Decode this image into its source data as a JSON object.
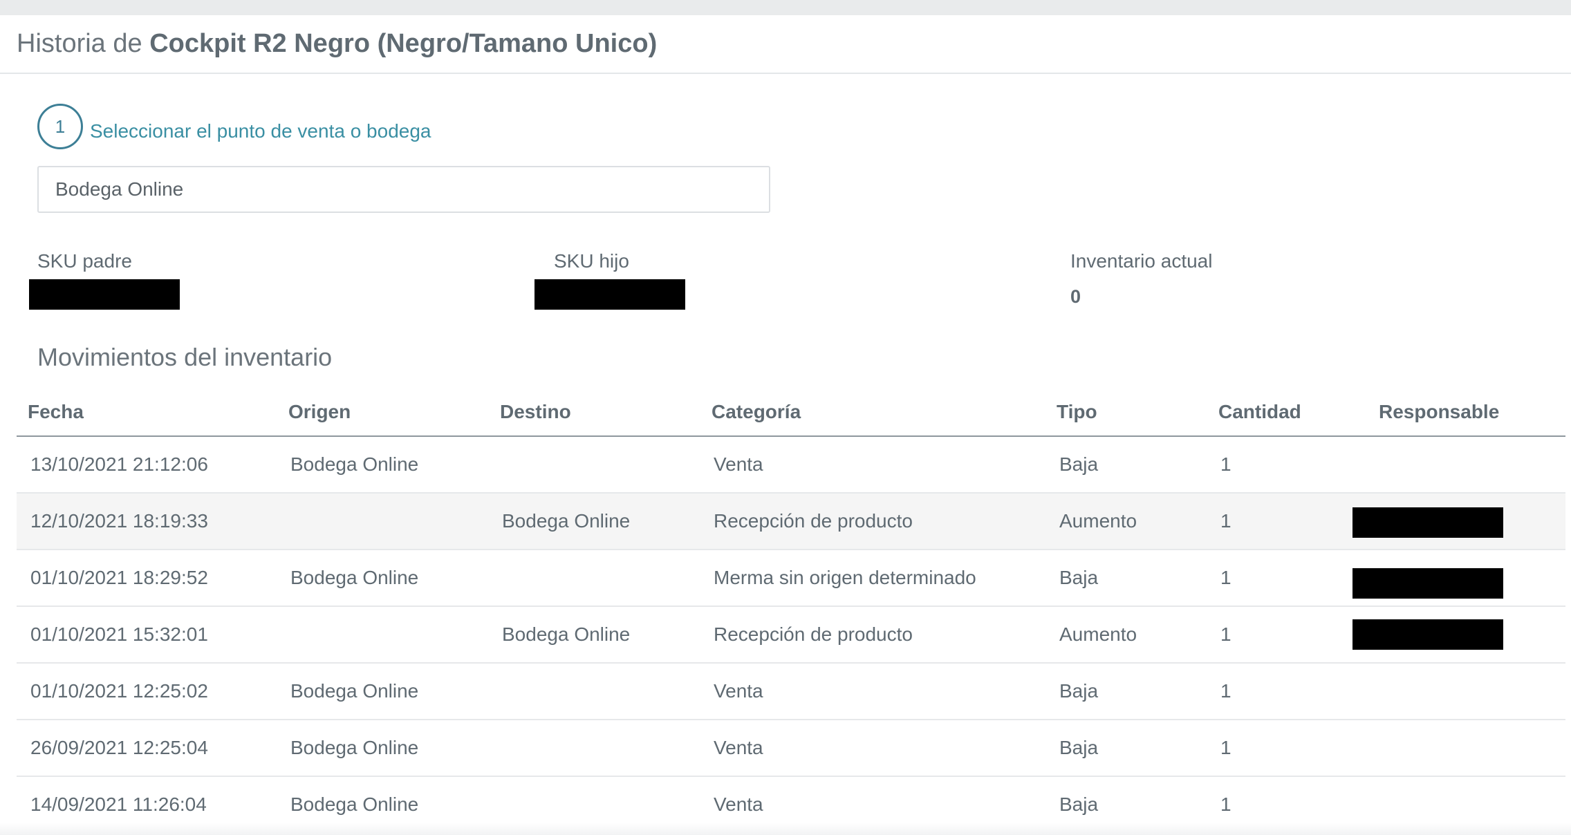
{
  "header": {
    "title_prefix": "Historia de",
    "product_name": "Cockpit R2 Negro (Negro/Tamano Unico)"
  },
  "step": {
    "number": "1",
    "label": "Seleccionar el punto de venta o bodega"
  },
  "location_select": {
    "value": "Bodega Online"
  },
  "info": {
    "sku_padre_label": "SKU padre",
    "sku_hijo_label": "SKU hijo",
    "inventario_label": "Inventario actual",
    "inventario_value": "0"
  },
  "movements": {
    "title": "Movimientos del inventario",
    "columns": {
      "fecha": "Fecha",
      "origen": "Origen",
      "destino": "Destino",
      "categoria": "Categoría",
      "tipo": "Tipo",
      "cantidad": "Cantidad",
      "responsable": "Responsable"
    },
    "rows": [
      {
        "fecha": "13/10/2021 21:12:06",
        "origen": "Bodega Online",
        "destino": "",
        "categoria": "Venta",
        "tipo": "Baja",
        "cantidad": "1"
      },
      {
        "fecha": "12/10/2021 18:19:33",
        "origen": "",
        "destino": "Bodega Online",
        "categoria": "Recepción de producto",
        "tipo": "Aumento",
        "cantidad": "1"
      },
      {
        "fecha": "01/10/2021 18:29:52",
        "origen": "Bodega Online",
        "destino": "",
        "categoria": "Merma sin origen determinado",
        "tipo": "Baja",
        "cantidad": "1"
      },
      {
        "fecha": "01/10/2021 15:32:01",
        "origen": "",
        "destino": "Bodega Online",
        "categoria": "Recepción de producto",
        "tipo": "Aumento",
        "cantidad": "1"
      },
      {
        "fecha": "01/10/2021 12:25:02",
        "origen": "Bodega Online",
        "destino": "",
        "categoria": "Venta",
        "tipo": "Baja",
        "cantidad": "1"
      },
      {
        "fecha": "26/09/2021 12:25:04",
        "origen": "Bodega Online",
        "destino": "",
        "categoria": "Venta",
        "tipo": "Baja",
        "cantidad": "1"
      },
      {
        "fecha": "14/09/2021 11:26:04",
        "origen": "Bodega Online",
        "destino": "",
        "categoria": "Venta",
        "tipo": "Baja",
        "cantidad": "1"
      }
    ]
  }
}
